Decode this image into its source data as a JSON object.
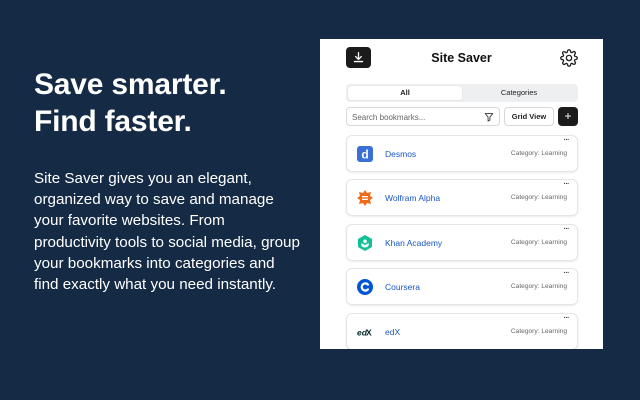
{
  "hero": {
    "headline_line1": "Save smarter.",
    "headline_line2": "Find faster.",
    "description": "Site Saver gives you an elegant, organized way to save and manage your favorite websites. From productivity tools to social media, group your bookmarks into categories and find exactly what you need instantly."
  },
  "app": {
    "title": "Site Saver",
    "download_icon": "download-icon",
    "settings_icon": "gear-icon",
    "tabs": [
      {
        "label": "All",
        "active": true
      },
      {
        "label": "Categories",
        "active": false
      }
    ],
    "search": {
      "placeholder": "Search bookmarks...",
      "value": ""
    },
    "filter_icon": "filter-icon",
    "grid_view_label": "Grid View",
    "add_label": "+",
    "more_label": "···",
    "bookmarks": [
      {
        "name": "Desmos",
        "category": "Category: Learning",
        "icon": "desmos-logo",
        "color": "#3b6fd6"
      },
      {
        "name": "Wolfram Alpha",
        "category": "Category: Learning",
        "icon": "wolfram-alpha-logo",
        "color": "#f06a1b"
      },
      {
        "name": "Khan Academy",
        "category": "Category: Learning",
        "icon": "khan-academy-logo",
        "color": "#14bf96"
      },
      {
        "name": "Coursera",
        "category": "Category: Learning",
        "icon": "coursera-logo",
        "color": "#0056d2"
      },
      {
        "name": "edX",
        "category": "Category: Learning",
        "icon": "edx-logo",
        "color": "#02262b"
      }
    ]
  },
  "colors": {
    "background": "#142a45",
    "accent_dark": "#1b1b1b",
    "link": "#1a56c4"
  }
}
